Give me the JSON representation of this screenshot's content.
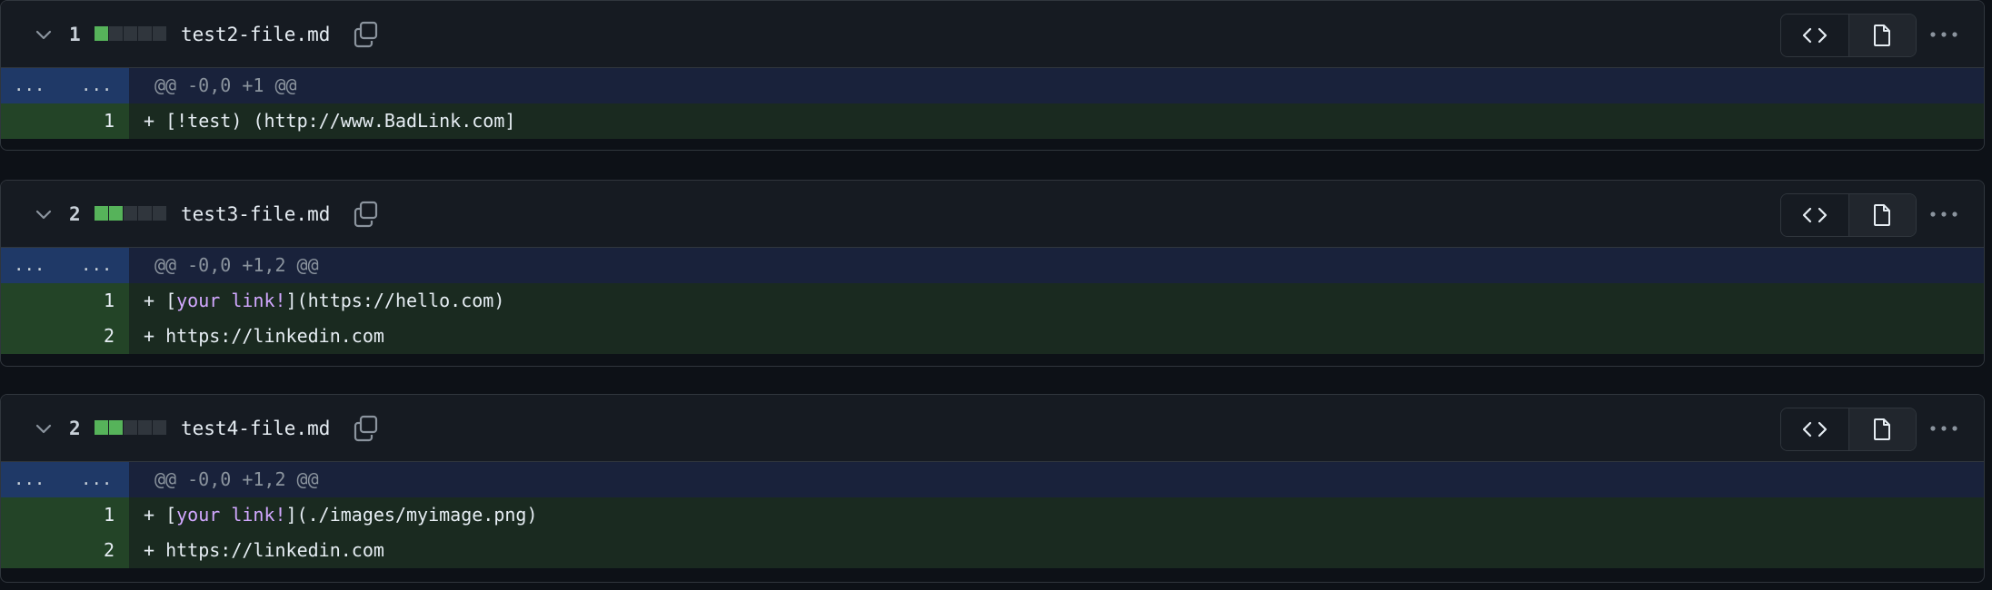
{
  "files": [
    {
      "change_count": "1",
      "diffstat": {
        "added_blocks": 1,
        "total_blocks": 5
      },
      "filename": "test2-file.md",
      "hunk_header": "@@ -0,0 +1 @@",
      "hunk_expand_left": "...",
      "hunk_expand_right": "...",
      "lines": [
        {
          "num": "1",
          "plus": "+ ",
          "pre": "[!test) (http://www.BadLink.com]",
          "kw": "",
          "post": ""
        }
      ]
    },
    {
      "change_count": "2",
      "diffstat": {
        "added_blocks": 2,
        "total_blocks": 5
      },
      "filename": "test3-file.md",
      "hunk_header": "@@ -0,0 +1,2 @@",
      "hunk_expand_left": "...",
      "hunk_expand_right": "...",
      "lines": [
        {
          "num": "1",
          "plus": "+ ",
          "pre": "[",
          "kw": "your link!",
          "post": "](https://hello.com)"
        },
        {
          "num": "2",
          "plus": "+ ",
          "pre": "https://linkedin.com",
          "kw": "",
          "post": ""
        }
      ]
    },
    {
      "change_count": "2",
      "diffstat": {
        "added_blocks": 2,
        "total_blocks": 5
      },
      "filename": "test4-file.md",
      "hunk_header": "@@ -0,0 +1,2 @@",
      "hunk_expand_left": "...",
      "hunk_expand_right": "...",
      "lines": [
        {
          "num": "1",
          "plus": "+ ",
          "pre": "[",
          "kw": "your link!",
          "post": "](./images/myimage.png)"
        },
        {
          "num": "2",
          "plus": "+ ",
          "pre": "https://linkedin.com",
          "kw": "",
          "post": ""
        }
      ]
    }
  ],
  "icons": {
    "collapse": "chevron-down-icon",
    "copy": "copy-icon",
    "code_view": "code-icon",
    "file_view": "file-icon",
    "more": "kebab-horizontal-icon"
  },
  "colors": {
    "addition": "#56b35a",
    "hunk_gutter": "#1f3967",
    "add_gutter": "#234427",
    "keyword": "#d2a8ff"
  }
}
